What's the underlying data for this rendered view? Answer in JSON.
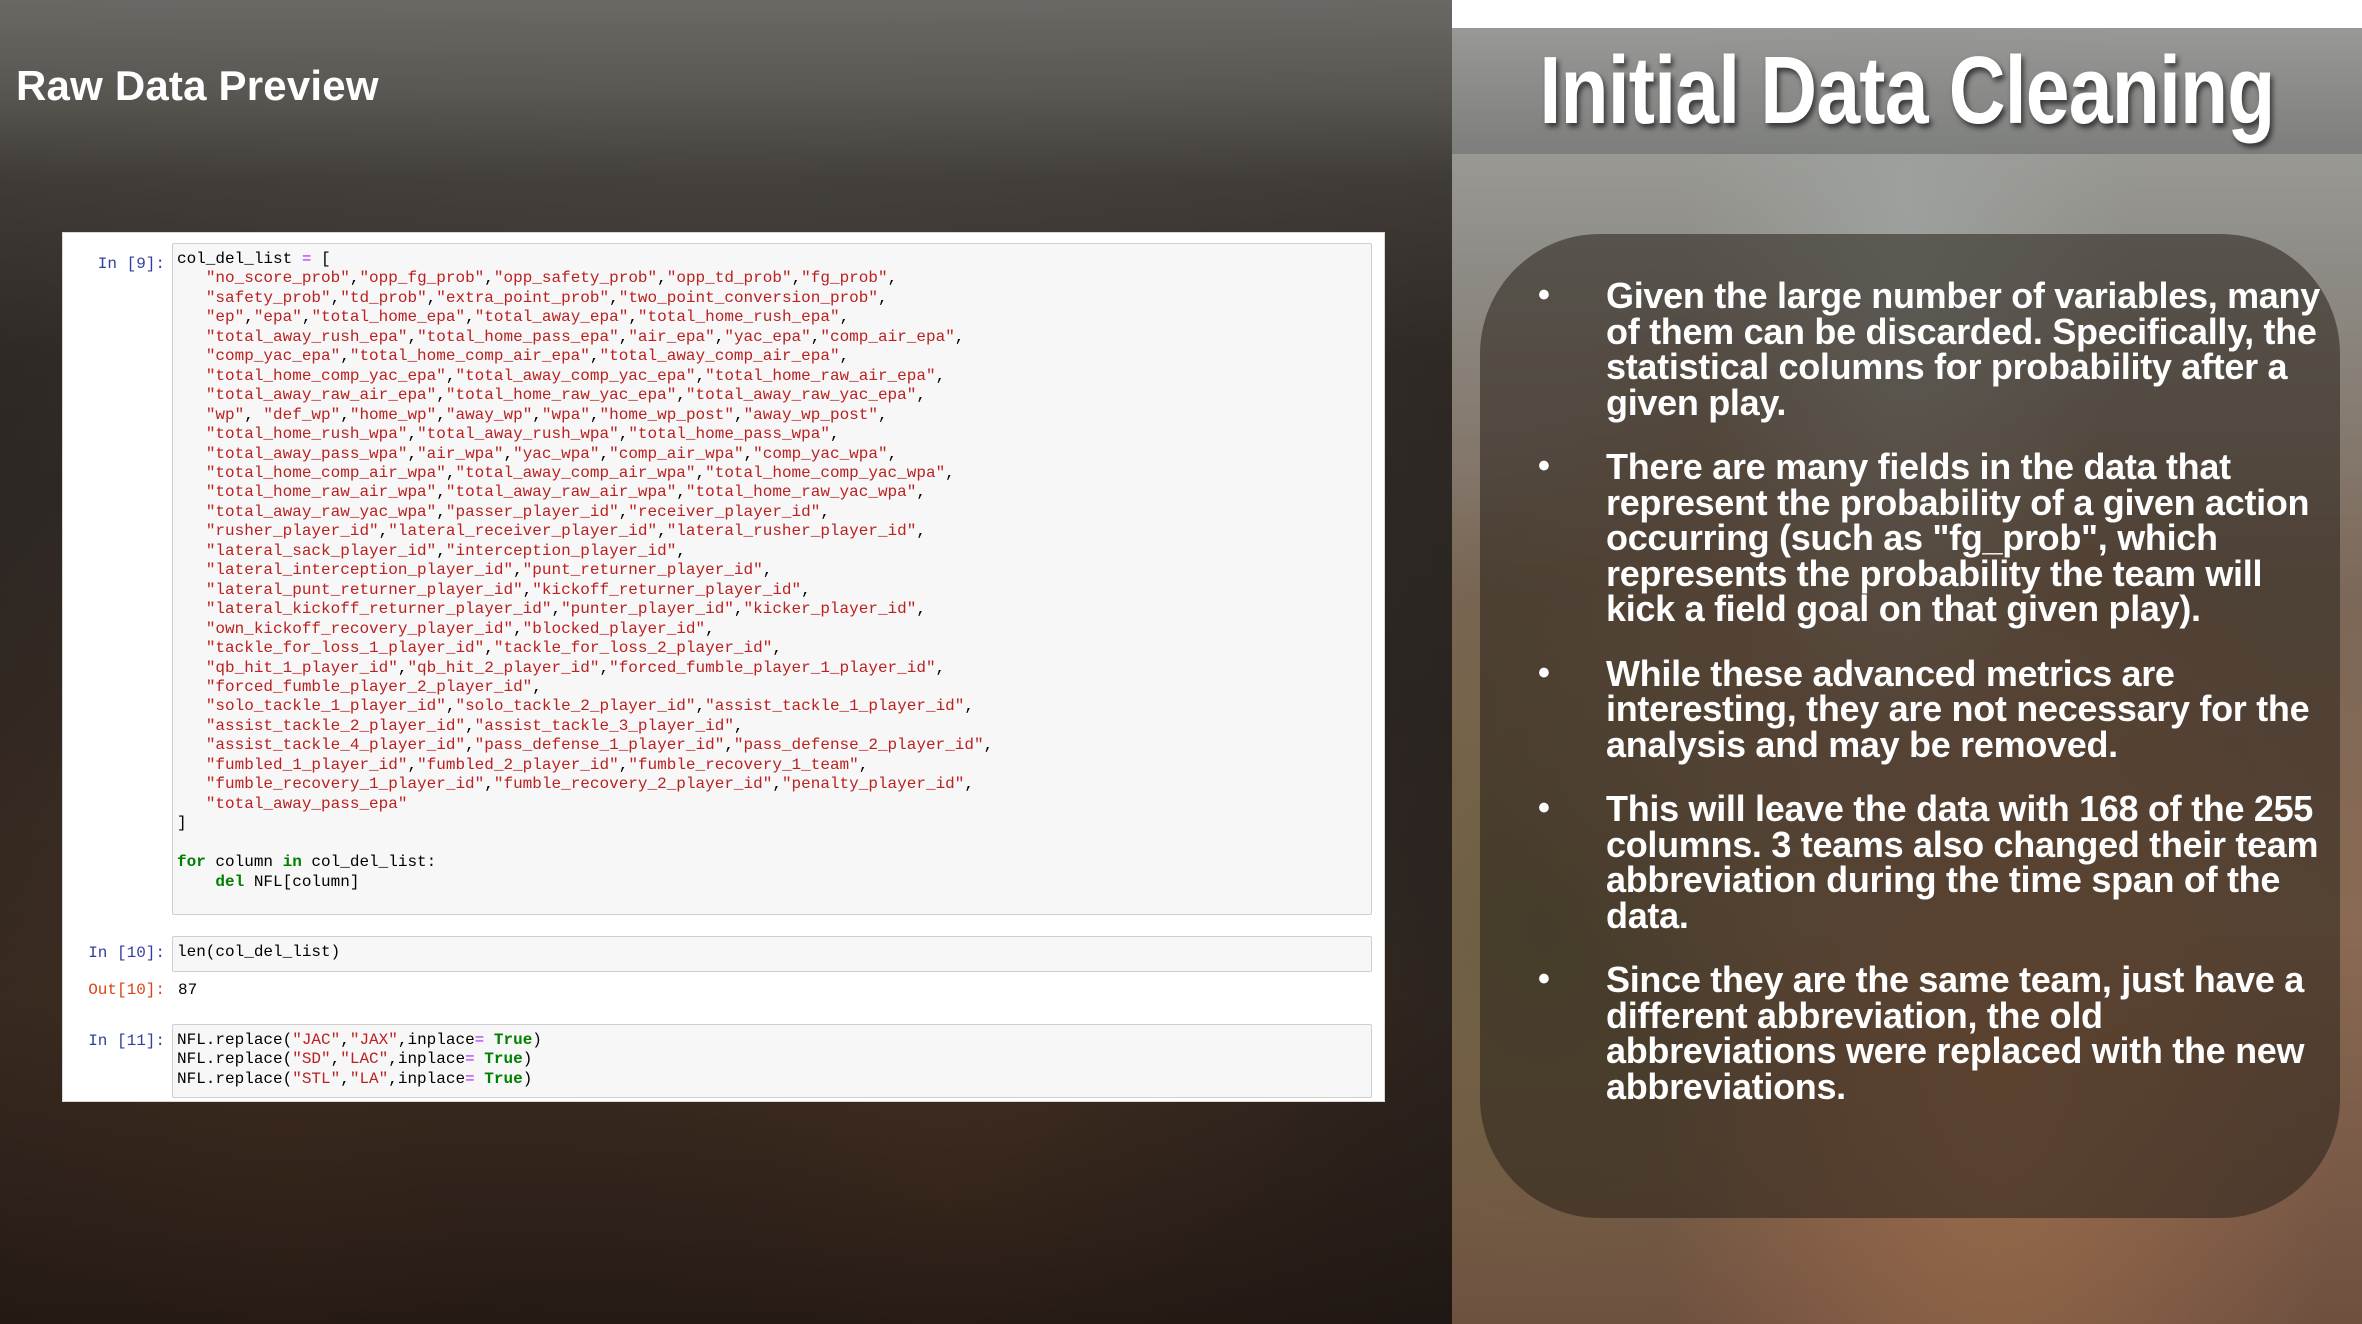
{
  "slide": {
    "left_title": "Raw Data Preview",
    "right_title": "Initial Data Cleaning"
  },
  "notebook": {
    "cells": [
      {
        "prompt": "In [9]:",
        "code_lines": [
          "col_del_list = [",
          "   \"no_score_prob\",\"opp_fg_prob\",\"opp_safety_prob\",\"opp_td_prob\",\"fg_prob\",",
          "   \"safety_prob\",\"td_prob\",\"extra_point_prob\",\"two_point_conversion_prob\",",
          "   \"ep\",\"epa\",\"total_home_epa\",\"total_away_epa\",\"total_home_rush_epa\",",
          "   \"total_away_rush_epa\",\"total_home_pass_epa\",\"air_epa\",\"yac_epa\",\"comp_air_epa\",",
          "   \"comp_yac_epa\",\"total_home_comp_air_epa\",\"total_away_comp_air_epa\",",
          "   \"total_home_comp_yac_epa\",\"total_away_comp_yac_epa\",\"total_home_raw_air_epa\",",
          "   \"total_away_raw_air_epa\",\"total_home_raw_yac_epa\",\"total_away_raw_yac_epa\",",
          "   \"wp\", \"def_wp\",\"home_wp\",\"away_wp\",\"wpa\",\"home_wp_post\",\"away_wp_post\",",
          "   \"total_home_rush_wpa\",\"total_away_rush_wpa\",\"total_home_pass_wpa\",",
          "   \"total_away_pass_wpa\",\"air_wpa\",\"yac_wpa\",\"comp_air_wpa\",\"comp_yac_wpa\",",
          "   \"total_home_comp_air_wpa\",\"total_away_comp_air_wpa\",\"total_home_comp_yac_wpa\",",
          "   \"total_home_raw_air_wpa\",\"total_away_raw_air_wpa\",\"total_home_raw_yac_wpa\",",
          "   \"total_away_raw_yac_wpa\",\"passer_player_id\",\"receiver_player_id\",",
          "   \"rusher_player_id\",\"lateral_receiver_player_id\",\"lateral_rusher_player_id\",",
          "   \"lateral_sack_player_id\",\"interception_player_id\",",
          "   \"lateral_interception_player_id\",\"punt_returner_player_id\",",
          "   \"lateral_punt_returner_player_id\",\"kickoff_returner_player_id\",",
          "   \"lateral_kickoff_returner_player_id\",\"punter_player_id\",\"kicker_player_id\",",
          "   \"own_kickoff_recovery_player_id\",\"blocked_player_id\",",
          "   \"tackle_for_loss_1_player_id\",\"tackle_for_loss_2_player_id\",",
          "   \"qb_hit_1_player_id\",\"qb_hit_2_player_id\",\"forced_fumble_player_1_player_id\",",
          "   \"forced_fumble_player_2_player_id\",",
          "   \"solo_tackle_1_player_id\",\"solo_tackle_2_player_id\",\"assist_tackle_1_player_id\",",
          "   \"assist_tackle_2_player_id\",\"assist_tackle_3_player_id\",",
          "   \"assist_tackle_4_player_id\",\"pass_defense_1_player_id\",\"pass_defense_2_player_id\",",
          "   \"fumbled_1_player_id\",\"fumbled_2_player_id\",\"fumble_recovery_1_team\",",
          "   \"fumble_recovery_1_player_id\",\"fumble_recovery_2_player_id\",\"penalty_player_id\",",
          "   \"total_away_pass_epa\"",
          "]",
          "",
          "for column in col_del_list:",
          "    del NFL[column]"
        ]
      },
      {
        "prompt": "In [10]:",
        "code_lines": [
          "len(col_del_list)"
        ],
        "output_prompt": "Out[10]:",
        "output": "87"
      },
      {
        "prompt": "In [11]:",
        "code_lines": [
          "NFL.replace(\"JAC\",\"JAX\",inplace= True)",
          "NFL.replace(\"SD\",\"LAC\",inplace= True)",
          "NFL.replace(\"STL\",\"LA\",inplace= True)"
        ]
      }
    ]
  },
  "bullets": [
    "Given the large number of variables, many of them can be discarded. Specifically, the statistical columns for probability after a given play.",
    "There are many fields in the data that represent the probability of a given action occurring (such as \"fg_prob\", which represents the probability the team will kick a field goal on that given play).",
    "While these advanced metrics are interesting, they are not necessary for the analysis and may be removed.",
    "This will leave the data with 168 of the 255 columns. 3 teams also changed their team abbreviation during the time span of the data.",
    "Since they are the same team, just have a different abbreviation, the old abbreviations were replaced with the new abbreviations."
  ],
  "bullet_symbol": "•"
}
